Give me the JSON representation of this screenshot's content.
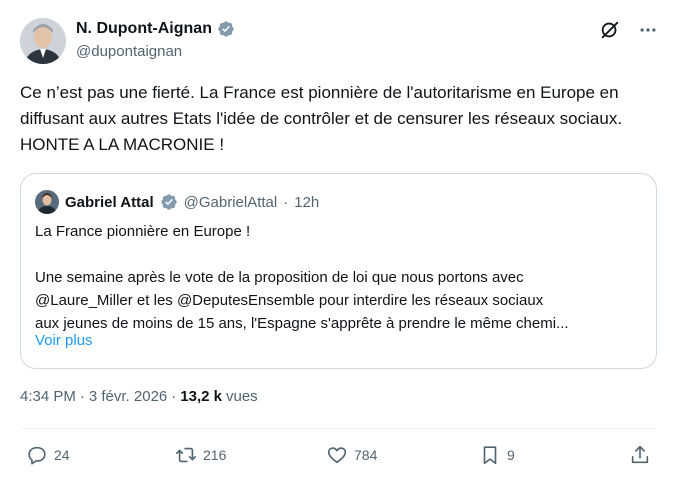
{
  "author": {
    "name": "N. Dupont-Aignan",
    "handle": "@dupontaignan"
  },
  "tweet": {
    "text": "Ce n’est pas une fierté. La France est pionnière de l'autoritarisme en Europe en diffusant aux autres Etats l'idée de contrôler et de censurer les réseaux sociaux. HONTE A LA MACRONIE !"
  },
  "quote": {
    "name": "Gabriel Attal",
    "handle": "@GabrielAttal",
    "separator": "·",
    "time": "12h",
    "line1": "La France pionnière en Europe !",
    "line2": "Une semaine après le vote de la proposition de loi que nous portons avec",
    "line3": "@Laure_Miller et les @DeputesEnsemble pour interdire les réseaux sociaux",
    "line4": "aux jeunes de moins de 15 ans, l'Espagne s'apprête à prendre le même chemi...",
    "show_more": "Voir plus"
  },
  "meta": {
    "time": "4:34 PM",
    "separator": "·",
    "date": "3 févr. 2026",
    "views_count": "13,2 k",
    "views_label": "vues"
  },
  "actions": {
    "replies": "24",
    "reposts": "216",
    "likes": "784",
    "bookmarks": "9"
  },
  "colors": {
    "accent": "#1d9bf0",
    "secondary_text": "#536471",
    "border": "#cfd9de"
  }
}
